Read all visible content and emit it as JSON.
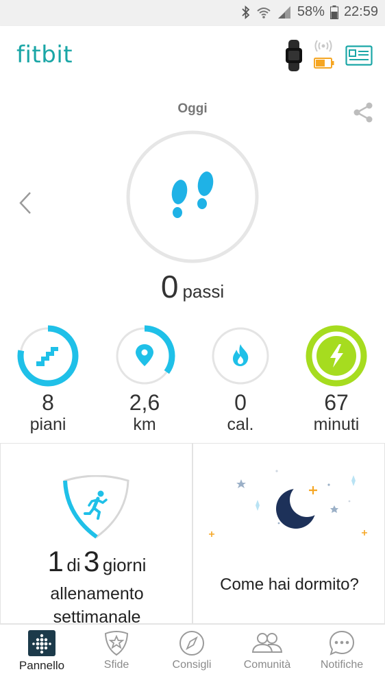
{
  "status_bar": {
    "battery_pct": "58%",
    "time": "22:59"
  },
  "app": {
    "logo": "fitbit"
  },
  "today": {
    "title": "Oggi",
    "steps_value": "0",
    "steps_unit": "passi"
  },
  "stats": [
    {
      "value": "8",
      "unit": "piani",
      "progress": 0.78,
      "color": "#1fc0e8",
      "icon": "stairs-icon"
    },
    {
      "value": "2,6",
      "unit": "km",
      "progress": 0.35,
      "color": "#1fc0e8",
      "icon": "location-pin-icon"
    },
    {
      "value": "0",
      "unit": "cal.",
      "progress": 0.0,
      "color": "#1fc0e8",
      "icon": "flame-icon"
    },
    {
      "value": "67",
      "unit": "minuti",
      "progress": 1.0,
      "color": "#a6dc1f",
      "icon": "lightning-icon"
    }
  ],
  "exercise": {
    "done": "1",
    "di": "di",
    "goal": "3",
    "giorni": "giorni",
    "label_line1": "allenamento",
    "label_line2": "settimanale",
    "progress": 0.33
  },
  "sleep": {
    "question": "Come hai dormito?"
  },
  "nav": [
    {
      "label": "Pannello",
      "icon": "dashboard-icon",
      "active": true
    },
    {
      "label": "Sfide",
      "icon": "challenges-star-icon"
    },
    {
      "label": "Consigli",
      "icon": "compass-icon"
    },
    {
      "label": "Comunità",
      "icon": "community-icon"
    },
    {
      "label": "Notifiche",
      "icon": "notifications-chat-icon"
    }
  ],
  "colors": {
    "accent_teal": "#1aa6a6",
    "ring_blue": "#1fc0e8",
    "ring_green": "#a6dc1f",
    "moon_navy": "#1d3159"
  }
}
